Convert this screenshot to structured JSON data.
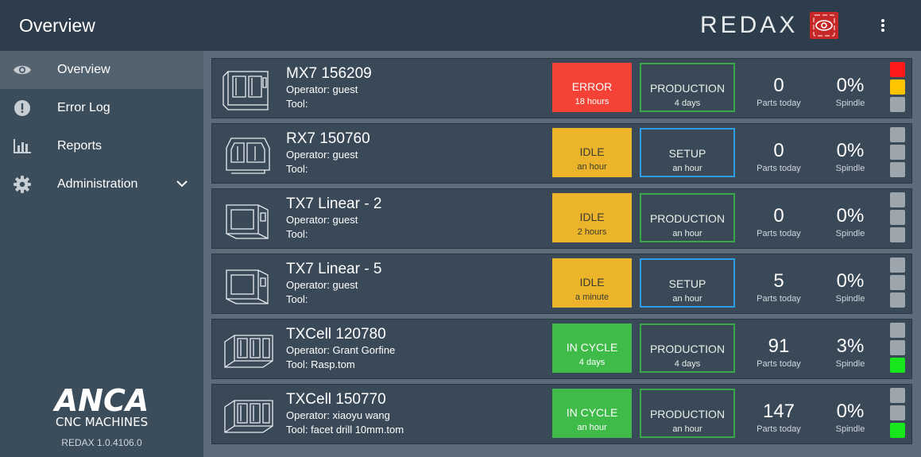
{
  "header": {
    "title": "Overview",
    "brand": "REDAX"
  },
  "sidebar": {
    "items": [
      {
        "label": "Overview",
        "icon": "eye-icon",
        "active": true
      },
      {
        "label": "Error Log",
        "icon": "alert-circle-icon"
      },
      {
        "label": "Reports",
        "icon": "bar-chart-icon"
      },
      {
        "label": "Administration",
        "icon": "gear-icon"
      }
    ],
    "logo_text": "ANCA",
    "logo_sub": "CNC MACHINES",
    "version": "REDAX 1.0.4106.0"
  },
  "machines": [
    {
      "name": "MX7 156209",
      "operator": "Operator: guest",
      "tool": "Tool:",
      "status": "ERROR",
      "status_dur": "18 hours",
      "mode": "PRODUCTION",
      "mode_dur": "4 days",
      "parts": "0",
      "parts_label": "Parts today",
      "spindle": "0%",
      "spindle_label": "Spindle",
      "lights": [
        "red",
        "yellow",
        "off"
      ]
    },
    {
      "name": "RX7 150760",
      "operator": "Operator: guest",
      "tool": "Tool:",
      "status": "IDLE",
      "status_dur": "an hour",
      "mode": "SETUP",
      "mode_dur": "an hour",
      "parts": "0",
      "parts_label": "Parts today",
      "spindle": "0%",
      "spindle_label": "Spindle",
      "lights": [
        "off",
        "off",
        "off"
      ]
    },
    {
      "name": "TX7 Linear - 2",
      "operator": "Operator: guest",
      "tool": "Tool:",
      "status": "IDLE",
      "status_dur": "2 hours",
      "mode": "PRODUCTION",
      "mode_dur": "an hour",
      "parts": "0",
      "parts_label": "Parts today",
      "spindle": "0%",
      "spindle_label": "Spindle",
      "lights": [
        "off",
        "off",
        "off"
      ]
    },
    {
      "name": "TX7 Linear - 5",
      "operator": "Operator: guest",
      "tool": "Tool:",
      "status": "IDLE",
      "status_dur": "a minute",
      "mode": "SETUP",
      "mode_dur": "an hour",
      "parts": "5",
      "parts_label": "Parts today",
      "spindle": "0%",
      "spindle_label": "Spindle",
      "lights": [
        "off",
        "off",
        "off"
      ]
    },
    {
      "name": "TXCell 120780",
      "operator": "Operator: Grant Gorfine",
      "tool": "Tool: Rasp.tom",
      "status": "IN CYCLE",
      "status_dur": "4 days",
      "mode": "PRODUCTION",
      "mode_dur": "4 days",
      "parts": "91",
      "parts_label": "Parts today",
      "spindle": "3%",
      "spindle_label": "Spindle",
      "lights": [
        "off",
        "off",
        "green"
      ]
    },
    {
      "name": "TXCell 150770",
      "operator": "Operator: xiaoyu wang",
      "tool": "Tool: facet drill 10mm.tom",
      "status": "IN CYCLE",
      "status_dur": "an hour",
      "mode": "PRODUCTION",
      "mode_dur": "an hour",
      "parts": "147",
      "parts_label": "Parts today",
      "spindle": "0%",
      "spindle_label": "Spindle",
      "lights": [
        "off",
        "off",
        "green"
      ]
    }
  ]
}
